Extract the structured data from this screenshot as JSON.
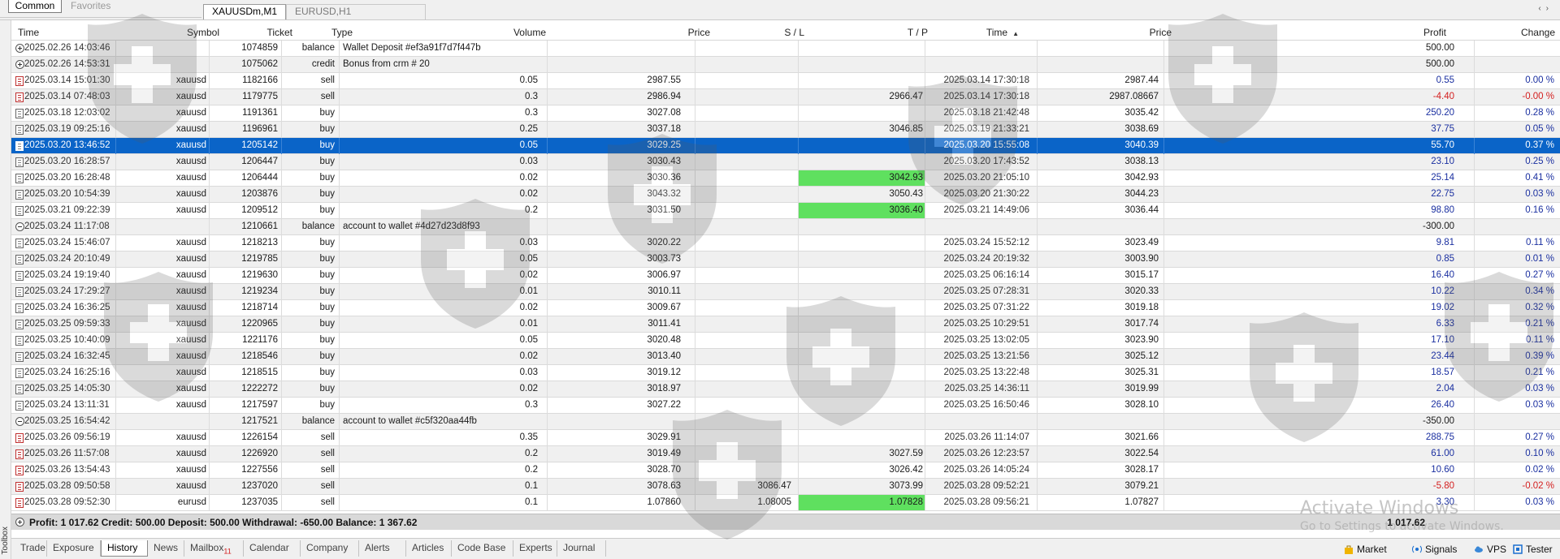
{
  "top_tabs": {
    "common": "Common",
    "favorites": "Favorites"
  },
  "chart_tabs": [
    {
      "label": "XAUUSDm,M1"
    },
    {
      "label": "EURUSD,H1"
    }
  ],
  "tab_scroll": {
    "left": "‹",
    "right": "›"
  },
  "columns": [
    "Time",
    "Symbol",
    "Ticket",
    "Type",
    "Volume",
    "Price",
    "S / L",
    "T / P",
    "Time",
    "Price",
    "Profit",
    "Change"
  ],
  "sort_arrow": "▲",
  "rows": [
    {
      "icon": "plus",
      "time": "2025.02.26 14:03:46",
      "symbol": "",
      "ticket": "1074859",
      "type": "balance",
      "comment": "Wallet Deposit #ef3a91f7d7f447b",
      "volume": "",
      "price": "",
      "sl": "",
      "tp": "",
      "time2": "",
      "price2": "",
      "profit": "500.00",
      "change": ""
    },
    {
      "icon": "plus",
      "time": "2025.02.26 14:53:31",
      "symbol": "",
      "ticket": "1075062",
      "type": "credit",
      "comment": "Bonus from crm # 20",
      "volume": "",
      "price": "",
      "sl": "",
      "tp": "",
      "time2": "",
      "price2": "",
      "profit": "500.00",
      "change": ""
    },
    {
      "icon": "sell",
      "time": "2025.03.14 15:01:30",
      "symbol": "xauusd",
      "ticket": "1182166",
      "type": "sell",
      "comment": "",
      "volume": "0.05",
      "price": "2987.55",
      "sl": "",
      "tp": "",
      "time2": "2025.03.14 17:30:18",
      "price2": "2987.44",
      "profit": "0.55",
      "change": "0.00 %"
    },
    {
      "icon": "sell",
      "time": "2025.03.14 07:48:03",
      "symbol": "xauusd",
      "ticket": "1179775",
      "type": "sell",
      "comment": "",
      "volume": "0.3",
      "price": "2986.94",
      "sl": "",
      "tp": "2966.47",
      "time2": "2025.03.14 17:30:18",
      "price2": "2987.08667",
      "profit": "-4.40",
      "change": "-0.00 %"
    },
    {
      "icon": "buy",
      "time": "2025.03.18 12:03:02",
      "symbol": "xauusd",
      "ticket": "1191361",
      "type": "buy",
      "comment": "",
      "volume": "0.3",
      "price": "3027.08",
      "sl": "",
      "tp": "",
      "time2": "2025.03.18 21:42:48",
      "price2": "3035.42",
      "profit": "250.20",
      "change": "0.28 %"
    },
    {
      "icon": "buy",
      "time": "2025.03.19 09:25:16",
      "symbol": "xauusd",
      "ticket": "1196961",
      "type": "buy",
      "comment": "",
      "volume": "0.25",
      "price": "3037.18",
      "sl": "",
      "tp": "3046.85",
      "time2": "2025.03.19 21:33:21",
      "price2": "3038.69",
      "profit": "37.75",
      "change": "0.05 %"
    },
    {
      "icon": "buy",
      "time": "2025.03.20 13:46:52",
      "symbol": "xauusd",
      "ticket": "1205142",
      "type": "buy",
      "comment": "",
      "volume": "0.05",
      "price": "3029.25",
      "sl": "",
      "tp": "",
      "time2": "2025.03.20 15:55:08",
      "price2": "3040.39",
      "profit": "55.70",
      "change": "0.37 %",
      "selected": true
    },
    {
      "icon": "buy",
      "time": "2025.03.20 16:28:57",
      "symbol": "xauusd",
      "ticket": "1206447",
      "type": "buy",
      "comment": "",
      "volume": "0.03",
      "price": "3030.43",
      "sl": "",
      "tp": "",
      "time2": "2025.03.20 17:43:52",
      "price2": "3038.13",
      "profit": "23.10",
      "change": "0.25 %"
    },
    {
      "icon": "buy",
      "time": "2025.03.20 16:28:48",
      "symbol": "xauusd",
      "ticket": "1206444",
      "type": "buy",
      "comment": "",
      "volume": "0.02",
      "price": "3030.36",
      "sl": "",
      "tp": "3042.93",
      "tp_hit": true,
      "time2": "2025.03.20 21:05:10",
      "price2": "3042.93",
      "profit": "25.14",
      "change": "0.41 %"
    },
    {
      "icon": "buy",
      "time": "2025.03.20 10:54:39",
      "symbol": "xauusd",
      "ticket": "1203876",
      "type": "buy",
      "comment": "",
      "volume": "0.02",
      "price": "3043.32",
      "sl": "",
      "tp": "3050.43",
      "time2": "2025.03.20 21:30:22",
      "price2": "3044.23",
      "profit": "22.75",
      "change": "0.03 %"
    },
    {
      "icon": "buy",
      "time": "2025.03.21 09:22:39",
      "symbol": "xauusd",
      "ticket": "1209512",
      "type": "buy",
      "comment": "",
      "volume": "0.2",
      "price": "3031.50",
      "sl": "",
      "tp": "3036.40",
      "tp_hit": true,
      "time2": "2025.03.21 14:49:06",
      "price2": "3036.44",
      "profit": "98.80",
      "change": "0.16 %"
    },
    {
      "icon": "minus",
      "time": "2025.03.24 11:17:08",
      "symbol": "",
      "ticket": "1210661",
      "type": "balance",
      "comment": "account to wallet #4d27d23d8f93",
      "volume": "",
      "price": "",
      "sl": "",
      "tp": "",
      "time2": "",
      "price2": "",
      "profit": "-300.00",
      "change": ""
    },
    {
      "icon": "buy",
      "time": "2025.03.24 15:46:07",
      "symbol": "xauusd",
      "ticket": "1218213",
      "type": "buy",
      "comment": "",
      "volume": "0.03",
      "price": "3020.22",
      "sl": "",
      "tp": "",
      "time2": "2025.03.24 15:52:12",
      "price2": "3023.49",
      "profit": "9.81",
      "change": "0.11 %"
    },
    {
      "icon": "buy",
      "time": "2025.03.24 20:10:49",
      "symbol": "xauusd",
      "ticket": "1219785",
      "type": "buy",
      "comment": "",
      "volume": "0.05",
      "price": "3003.73",
      "sl": "",
      "tp": "",
      "time2": "2025.03.24 20:19:32",
      "price2": "3003.90",
      "profit": "0.85",
      "change": "0.01 %"
    },
    {
      "icon": "buy",
      "time": "2025.03.24 19:19:40",
      "symbol": "xauusd",
      "ticket": "1219630",
      "type": "buy",
      "comment": "",
      "volume": "0.02",
      "price": "3006.97",
      "sl": "",
      "tp": "",
      "time2": "2025.03.25 06:16:14",
      "price2": "3015.17",
      "profit": "16.40",
      "change": "0.27 %"
    },
    {
      "icon": "buy",
      "time": "2025.03.24 17:29:27",
      "symbol": "xauusd",
      "ticket": "1219234",
      "type": "buy",
      "comment": "",
      "volume": "0.01",
      "price": "3010.11",
      "sl": "",
      "tp": "",
      "time2": "2025.03.25 07:28:31",
      "price2": "3020.33",
      "profit": "10.22",
      "change": "0.34 %"
    },
    {
      "icon": "buy",
      "time": "2025.03.24 16:36:25",
      "symbol": "xauusd",
      "ticket": "1218714",
      "type": "buy",
      "comment": "",
      "volume": "0.02",
      "price": "3009.67",
      "sl": "",
      "tp": "",
      "time2": "2025.03.25 07:31:22",
      "price2": "3019.18",
      "profit": "19.02",
      "change": "0.32 %"
    },
    {
      "icon": "buy",
      "time": "2025.03.25 09:59:33",
      "symbol": "xauusd",
      "ticket": "1220965",
      "type": "buy",
      "comment": "",
      "volume": "0.01",
      "price": "3011.41",
      "sl": "",
      "tp": "",
      "time2": "2025.03.25 10:29:51",
      "price2": "3017.74",
      "profit": "6.33",
      "change": "0.21 %"
    },
    {
      "icon": "buy",
      "time": "2025.03.25 10:40:09",
      "symbol": "xauusd",
      "ticket": "1221176",
      "type": "buy",
      "comment": "",
      "volume": "0.05",
      "price": "3020.48",
      "sl": "",
      "tp": "",
      "time2": "2025.03.25 13:02:05",
      "price2": "3023.90",
      "profit": "17.10",
      "change": "0.11 %"
    },
    {
      "icon": "buy",
      "time": "2025.03.24 16:32:45",
      "symbol": "xauusd",
      "ticket": "1218546",
      "type": "buy",
      "comment": "",
      "volume": "0.02",
      "price": "3013.40",
      "sl": "",
      "tp": "",
      "time2": "2025.03.25 13:21:56",
      "price2": "3025.12",
      "profit": "23.44",
      "change": "0.39 %"
    },
    {
      "icon": "buy",
      "time": "2025.03.24 16:25:16",
      "symbol": "xauusd",
      "ticket": "1218515",
      "type": "buy",
      "comment": "",
      "volume": "0.03",
      "price": "3019.12",
      "sl": "",
      "tp": "",
      "time2": "2025.03.25 13:22:48",
      "price2": "3025.31",
      "profit": "18.57",
      "change": "0.21 %"
    },
    {
      "icon": "buy",
      "time": "2025.03.25 14:05:30",
      "symbol": "xauusd",
      "ticket": "1222272",
      "type": "buy",
      "comment": "",
      "volume": "0.02",
      "price": "3018.97",
      "sl": "",
      "tp": "",
      "time2": "2025.03.25 14:36:11",
      "price2": "3019.99",
      "profit": "2.04",
      "change": "0.03 %"
    },
    {
      "icon": "buy",
      "time": "2025.03.24 13:11:31",
      "symbol": "xauusd",
      "ticket": "1217597",
      "type": "buy",
      "comment": "",
      "volume": "0.3",
      "price": "3027.22",
      "sl": "",
      "tp": "",
      "time2": "2025.03.25 16:50:46",
      "price2": "3028.10",
      "profit": "26.40",
      "change": "0.03 %"
    },
    {
      "icon": "minus",
      "time": "2025.03.25 16:54:42",
      "symbol": "",
      "ticket": "1217521",
      "type": "balance",
      "comment": "account to wallet #c5f320aa44fb",
      "volume": "",
      "price": "",
      "sl": "",
      "tp": "",
      "time2": "",
      "price2": "",
      "profit": "-350.00",
      "change": ""
    },
    {
      "icon": "sell",
      "time": "2025.03.26 09:56:19",
      "symbol": "xauusd",
      "ticket": "1226154",
      "type": "sell",
      "comment": "",
      "volume": "0.35",
      "price": "3029.91",
      "sl": "",
      "tp": "",
      "time2": "2025.03.26 11:14:07",
      "price2": "3021.66",
      "profit": "288.75",
      "change": "0.27 %"
    },
    {
      "icon": "sell",
      "time": "2025.03.26 11:57:08",
      "symbol": "xauusd",
      "ticket": "1226920",
      "type": "sell",
      "comment": "",
      "volume": "0.2",
      "price": "3019.49",
      "sl": "",
      "tp": "3027.59",
      "time2": "2025.03.26 12:23:57",
      "price2": "3022.54",
      "profit": "61.00",
      "change": "0.10 %"
    },
    {
      "icon": "sell",
      "time": "2025.03.26 13:54:43",
      "symbol": "xauusd",
      "ticket": "1227556",
      "type": "sell",
      "comment": "",
      "volume": "0.2",
      "price": "3028.70",
      "sl": "",
      "tp": "3026.42",
      "time2": "2025.03.26 14:05:24",
      "price2": "3028.17",
      "profit": "10.60",
      "change": "0.02 %"
    },
    {
      "icon": "sell",
      "time": "2025.03.28 09:50:58",
      "symbol": "xauusd",
      "ticket": "1237020",
      "type": "sell",
      "comment": "",
      "volume": "0.1",
      "price": "3078.63",
      "sl": "3086.47",
      "tp": "3073.99",
      "time2": "2025.03.28 09:52:21",
      "price2": "3079.21",
      "profit": "-5.80",
      "change": "-0.02 %"
    },
    {
      "icon": "sell",
      "time": "2025.03.28 09:52:30",
      "symbol": "eurusd",
      "ticket": "1237035",
      "type": "sell",
      "comment": "",
      "volume": "0.1",
      "price": "1.07860",
      "sl": "1.08005",
      "tp": "1.07828",
      "tp_hit": true,
      "time2": "2025.03.28 09:56:21",
      "price2": "1.07827",
      "profit": "3.30",
      "change": "0.03 %"
    }
  ],
  "summary": {
    "text": "Profit: 1 017.62  Credit: 500.00  Deposit: 500.00  Withdrawal: -650.00  Balance: 1 367.62",
    "profit": "1 017.62"
  },
  "watermark": {
    "line1": "Activate Windows",
    "line2": "Go to Settings to activate Windows."
  },
  "toolbox_label": "Toolbox",
  "bottom_tabs": [
    {
      "label": "Trade"
    },
    {
      "label": "Exposure"
    },
    {
      "label": "History",
      "active": true
    },
    {
      "label": "News"
    },
    {
      "label": "Mailbox",
      "badge": "11"
    },
    {
      "label": "Calendar"
    },
    {
      "label": "Company"
    },
    {
      "label": "Alerts"
    },
    {
      "label": "Articles"
    },
    {
      "label": "Code Base"
    },
    {
      "label": "Experts"
    },
    {
      "label": "Journal"
    }
  ],
  "right_tools": [
    {
      "label": "Market",
      "icon": "bag-icon"
    },
    {
      "label": "Signals",
      "icon": "signal-icon"
    },
    {
      "label": "VPS",
      "icon": "cloud-icon"
    },
    {
      "label": "Tester",
      "icon": "tester-icon"
    }
  ],
  "colors": {
    "selected": "#0a64c8",
    "tp_hit": "#5fe05f",
    "negative": "#d42020",
    "positive": "#1a2fa0"
  }
}
